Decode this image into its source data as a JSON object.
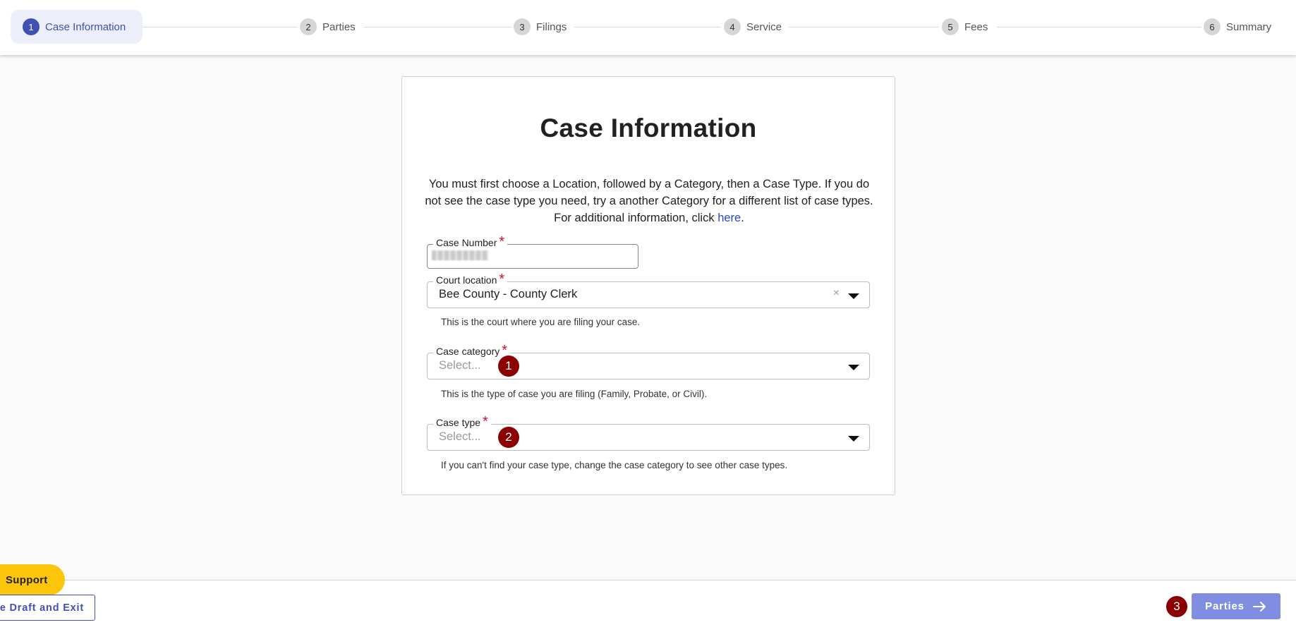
{
  "stepper": {
    "steps": [
      {
        "num": "1",
        "label": "Case Information"
      },
      {
        "num": "2",
        "label": "Parties"
      },
      {
        "num": "3",
        "label": "Filings"
      },
      {
        "num": "4",
        "label": "Service"
      },
      {
        "num": "5",
        "label": "Fees"
      },
      {
        "num": "6",
        "label": "Summary"
      }
    ],
    "active_step": 1
  },
  "card": {
    "title": "Case Information",
    "intro": "You must first choose a Location, followed by a Category, then a Case Type. If you do not see the case type you need, try a another Category for a different list of case types. For additional information, click ",
    "intro_link": "here",
    "intro_end": ".",
    "case_number": {
      "label": "Case Number",
      "required": "*"
    },
    "court_location": {
      "label": "Court location",
      "required": "*",
      "value": "Bee County - County Clerk",
      "clear": "×",
      "helper": "This is the court where you are filing your case."
    },
    "case_category": {
      "label": "Case category",
      "required": "*",
      "placeholder": "Select...",
      "helper": "This is the type of case you are filing (Family, Probate, or Civil)."
    },
    "case_type": {
      "label": "Case type",
      "required": "*",
      "placeholder": "Select...",
      "helper": "If you can't find your case type, change the case category to see other case types."
    }
  },
  "annotations": {
    "badge1": "1",
    "badge2": "2",
    "badge3": "3"
  },
  "footer": {
    "support_label": "Support",
    "draft_label": "e Draft and Exit",
    "next_label": "Parties"
  },
  "colors": {
    "primary": "#3f51b5",
    "next_button": "#7f8ee0",
    "support": "#fdc60a",
    "required": "#c8102e",
    "badge": "#8b0000"
  }
}
